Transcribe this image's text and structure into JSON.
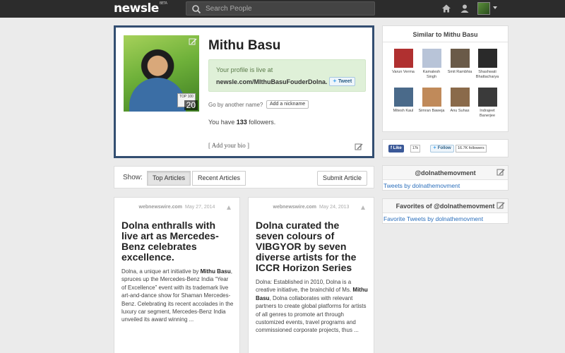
{
  "topbar": {
    "logo": "newsle",
    "logo_badge": "BETA",
    "search_placeholder": "Search People"
  },
  "profile": {
    "name": "Mithu Basu",
    "photo_badge": "TOP 100",
    "photo_count": "20",
    "live_message": "Your profile is live at",
    "profile_url": "newsle.com/MIthuBasuFouderDolna",
    "tweet_label": "Tweet",
    "nickname_prompt": "Go by another name?",
    "nickname_button": "Add a nickname",
    "followers_prefix": "You have",
    "followers_count": "133",
    "followers_suffix": "followers.",
    "bio_prompt": "[ Add your bio ]"
  },
  "articles_bar": {
    "show_label": "Show:",
    "tabs": [
      {
        "label": "Top Articles",
        "active": true
      },
      {
        "label": "Recent Articles",
        "active": false
      }
    ],
    "submit_label": "Submit Article"
  },
  "articles": [
    {
      "source": "webnewswire.com",
      "date": "May 27, 2014",
      "title": "Dolna enthralls with live art as Mercedes-Benz celebrates excellence.",
      "body_pre": "Dolna, a unique art initiative by ",
      "body_bold": "Mithu Basu",
      "body_post": ", spruces up the Mercedes-Benz India “Year of Excellence” event with its trademark live art-and-dance show for Shaman Mercedes-Benz. Celebrating its recent accolades in the luxury car segment, Mercedes-Benz India unveiled its award winning ..."
    },
    {
      "source": "webnewswire.com",
      "date": "May 24, 2013",
      "title": "Dolna curated the seven colours of VIBGYOR by seven diverse artists for the ICCR Horizon Series",
      "body_pre": "Dolna: Established in 2010, Dolna is a creative initiative, the brainchild of Ms. ",
      "body_bold": "Mithu Basu",
      "body_post": ", Dolna collaborates with relevant partners to create global platforms for artists of all genres to promote art through customized events, travel programs and commissioned corporate projects, thus ..."
    }
  ],
  "similar": {
    "title": "Similar to Mithu Basu",
    "people": [
      {
        "name": "Varun Verma",
        "color": "#b03030"
      },
      {
        "name": "Kamalesh Singh",
        "color": "#b8c4d8"
      },
      {
        "name": "Smit Rambhia",
        "color": "#6a5a48"
      },
      {
        "name": "Shashwati Bhattacharya",
        "color": "#2a2a2a"
      },
      {
        "name": "Mitesh Kaul",
        "color": "#4a6a8a"
      },
      {
        "name": "Simran Baweja",
        "color": "#c08a5a"
      },
      {
        "name": "Anu Suhas",
        "color": "#8a6a4a"
      },
      {
        "name": "Indrajeet Banerjee",
        "color": "#3a3a3a"
      }
    ]
  },
  "social": {
    "like_label": "Like",
    "like_count": "17k",
    "follow_label": "Follow",
    "follow_count": "16.7K followers"
  },
  "twitter_feed": {
    "title": "@dolnathemovment",
    "link": "Tweets by dolnathemovment"
  },
  "favorites_feed": {
    "title": "Favorites of @dolnathemovment",
    "link": "Favorite Tweets by dolnathemovment"
  },
  "colors": {
    "topbar_bg": "#2c2c2c",
    "card_border": "#334e71",
    "live_box_bg": "#dff0d8",
    "link_blue": "#2a6ebb",
    "facebook_blue": "#3b5998"
  }
}
